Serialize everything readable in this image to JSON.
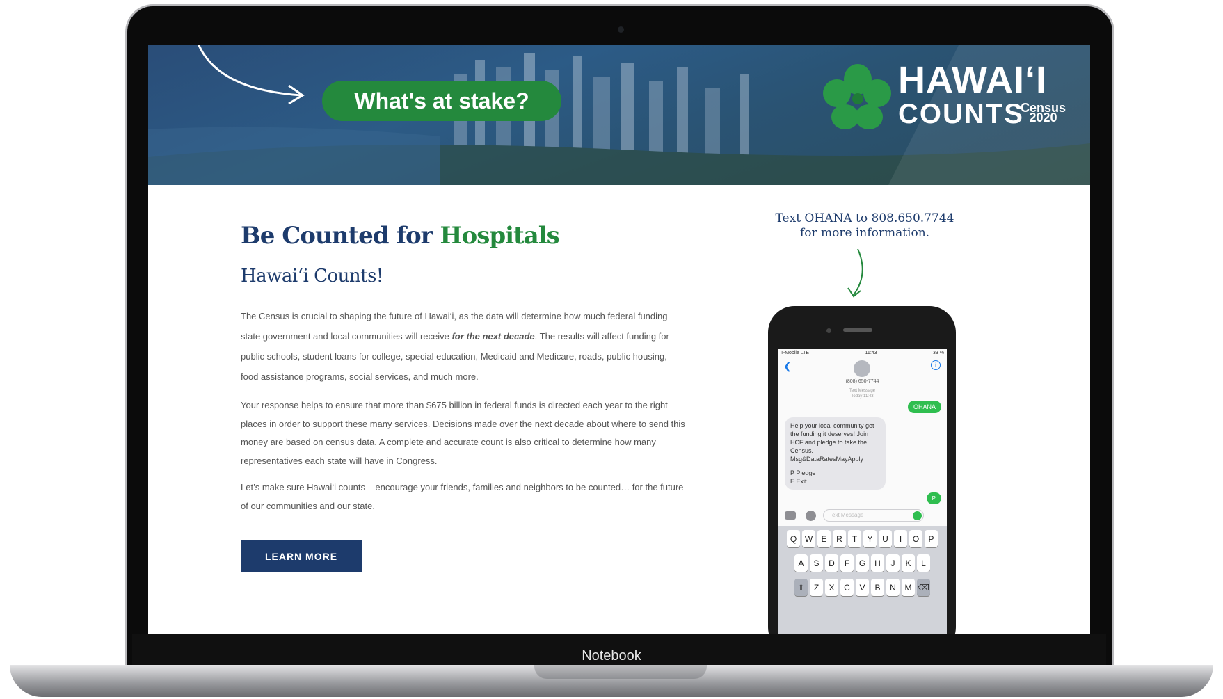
{
  "device": {
    "label": "Notebook"
  },
  "banner": {
    "stake_label": "What's at stake?",
    "logo_line1": "HAWAI‘I",
    "logo_line2": "COUNTS",
    "logo_census_1": "Census",
    "logo_census_2": "2020"
  },
  "content": {
    "headline_part1": "Be Counted for ",
    "headline_part2": "Hospitals",
    "subhead": "Hawai‘i Counts!",
    "p1_a": "The Census is crucial to shaping the future of Hawai‘i, as the data will determine how much federal funding state government and local communities will receive ",
    "p1_em": "for the next decade",
    "p1_b": ". The results will affect funding for public schools, student loans for college, special education, Medicaid and Medicare, roads, public housing, food assistance programs, social services, and much more.",
    "p2": "Your response helps to ensure that more than $675 billion in federal funds is directed each year to the right places in order to support these many services. Decisions made over the next decade about where to send this money are based on census data. A complete and accurate count is also critical to determine how many representatives each state will have in Congress.",
    "p3": "Let’s make sure Hawai‘i counts – encourage your friends, families and neighbors to be counted… for the future of our communities and our state.",
    "button_label": "LEARN MORE"
  },
  "text_info": {
    "line1": "Text OHANA to 808.650.7744",
    "line2": "for more information."
  },
  "phone": {
    "carrier": "T-Mobile LTE",
    "time": "11:43",
    "battery": "33 %",
    "contact": "(808) 650-7744",
    "meta_1": "Text Message",
    "meta_2": "Today 11:43",
    "outgoing_1": "OHANA",
    "incoming": "Help your local community get the funding it deserves! Join HCF and pledge to take the Census. Msg&DataRatesMayApply",
    "incoming_2": "P Pledge",
    "incoming_3": "E Exit",
    "outgoing_2": "P",
    "input_placeholder": "Text Message",
    "keyboard": {
      "row1": [
        "Q",
        "W",
        "E",
        "R",
        "T",
        "Y",
        "U",
        "I",
        "O",
        "P"
      ],
      "row2": [
        "A",
        "S",
        "D",
        "F",
        "G",
        "H",
        "J",
        "K",
        "L"
      ],
      "row3": [
        "Z",
        "X",
        "C",
        "V",
        "B",
        "N",
        "M"
      ]
    }
  },
  "colors": {
    "navy": "#1d3b6c",
    "green": "#24893d",
    "imessage_green": "#2fbe4f"
  }
}
